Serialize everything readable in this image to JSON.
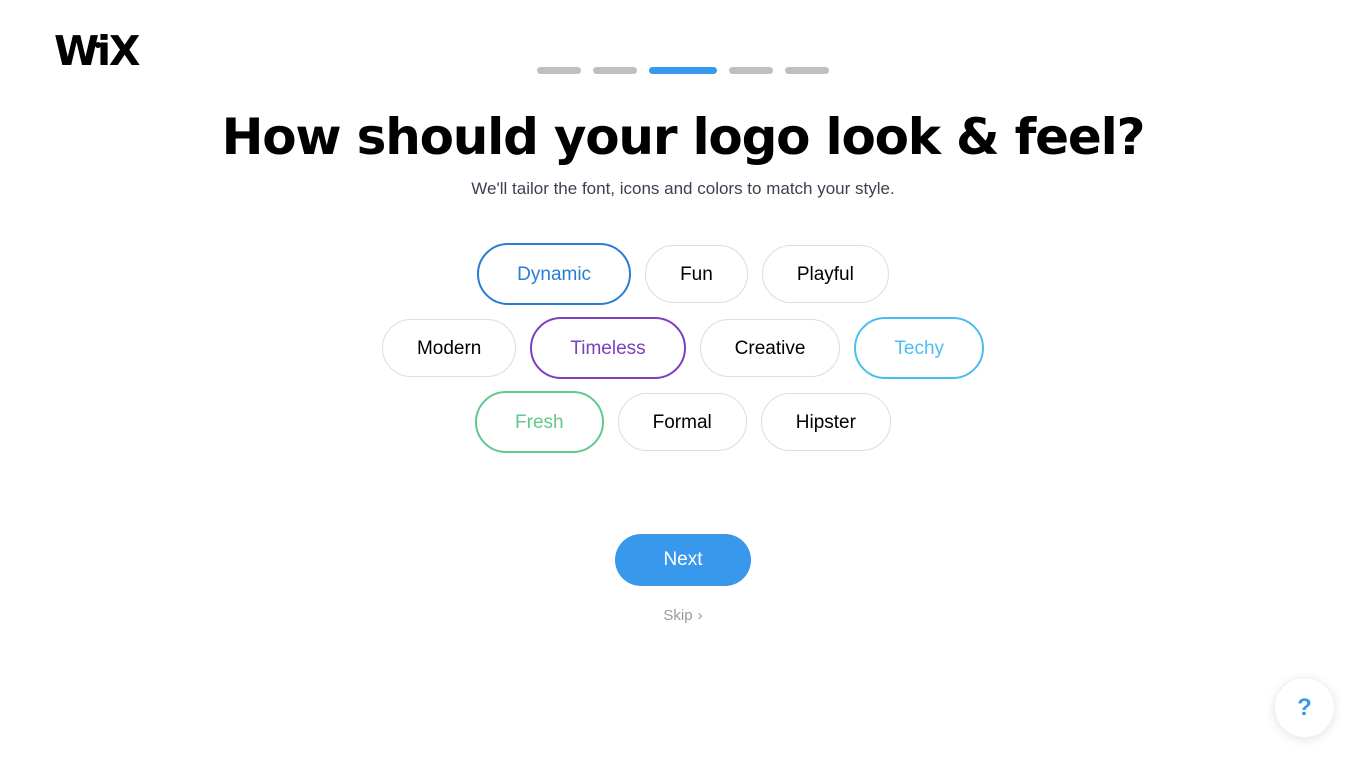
{
  "brand": {
    "logo_text": "WiX",
    "logo_pre": "W",
    "logo_mid": "i",
    "logo_post": "X"
  },
  "progress": {
    "steps": [
      {
        "state": "inactive"
      },
      {
        "state": "inactive"
      },
      {
        "state": "active"
      },
      {
        "state": "inactive"
      },
      {
        "state": "inactive"
      }
    ],
    "current_step": 3,
    "total_steps": 5,
    "active_color": "#3899ec",
    "inactive_color": "#bfbfbf"
  },
  "header": {
    "title": "How should your logo look & feel?",
    "subtitle": "We'll tailor the font, icons and colors to match your style."
  },
  "chips": {
    "rows": [
      [
        {
          "label": "Dynamic",
          "selected": true,
          "color": "#2b7cd3"
        },
        {
          "label": "Fun",
          "selected": false,
          "color": "#000000"
        },
        {
          "label": "Playful",
          "selected": false,
          "color": "#000000"
        }
      ],
      [
        {
          "label": "Modern",
          "selected": false,
          "color": "#000000"
        },
        {
          "label": "Timeless",
          "selected": true,
          "color": "#7b3fbf"
        },
        {
          "label": "Creative",
          "selected": false,
          "color": "#000000"
        },
        {
          "label": "Techy",
          "selected": true,
          "color": "#4bbdf2"
        }
      ],
      [
        {
          "label": "Fresh",
          "selected": true,
          "color": "#5fc98e"
        },
        {
          "label": "Formal",
          "selected": false,
          "color": "#000000"
        },
        {
          "label": "Hipster",
          "selected": false,
          "color": "#000000"
        }
      ]
    ],
    "unselected_border_color": "#dddddd"
  },
  "actions": {
    "next_label": "Next",
    "next_color": "#3899ec",
    "skip_label": "Skip",
    "skip_chevron": "›"
  },
  "help": {
    "glyph": "?",
    "color": "#3899ec"
  }
}
